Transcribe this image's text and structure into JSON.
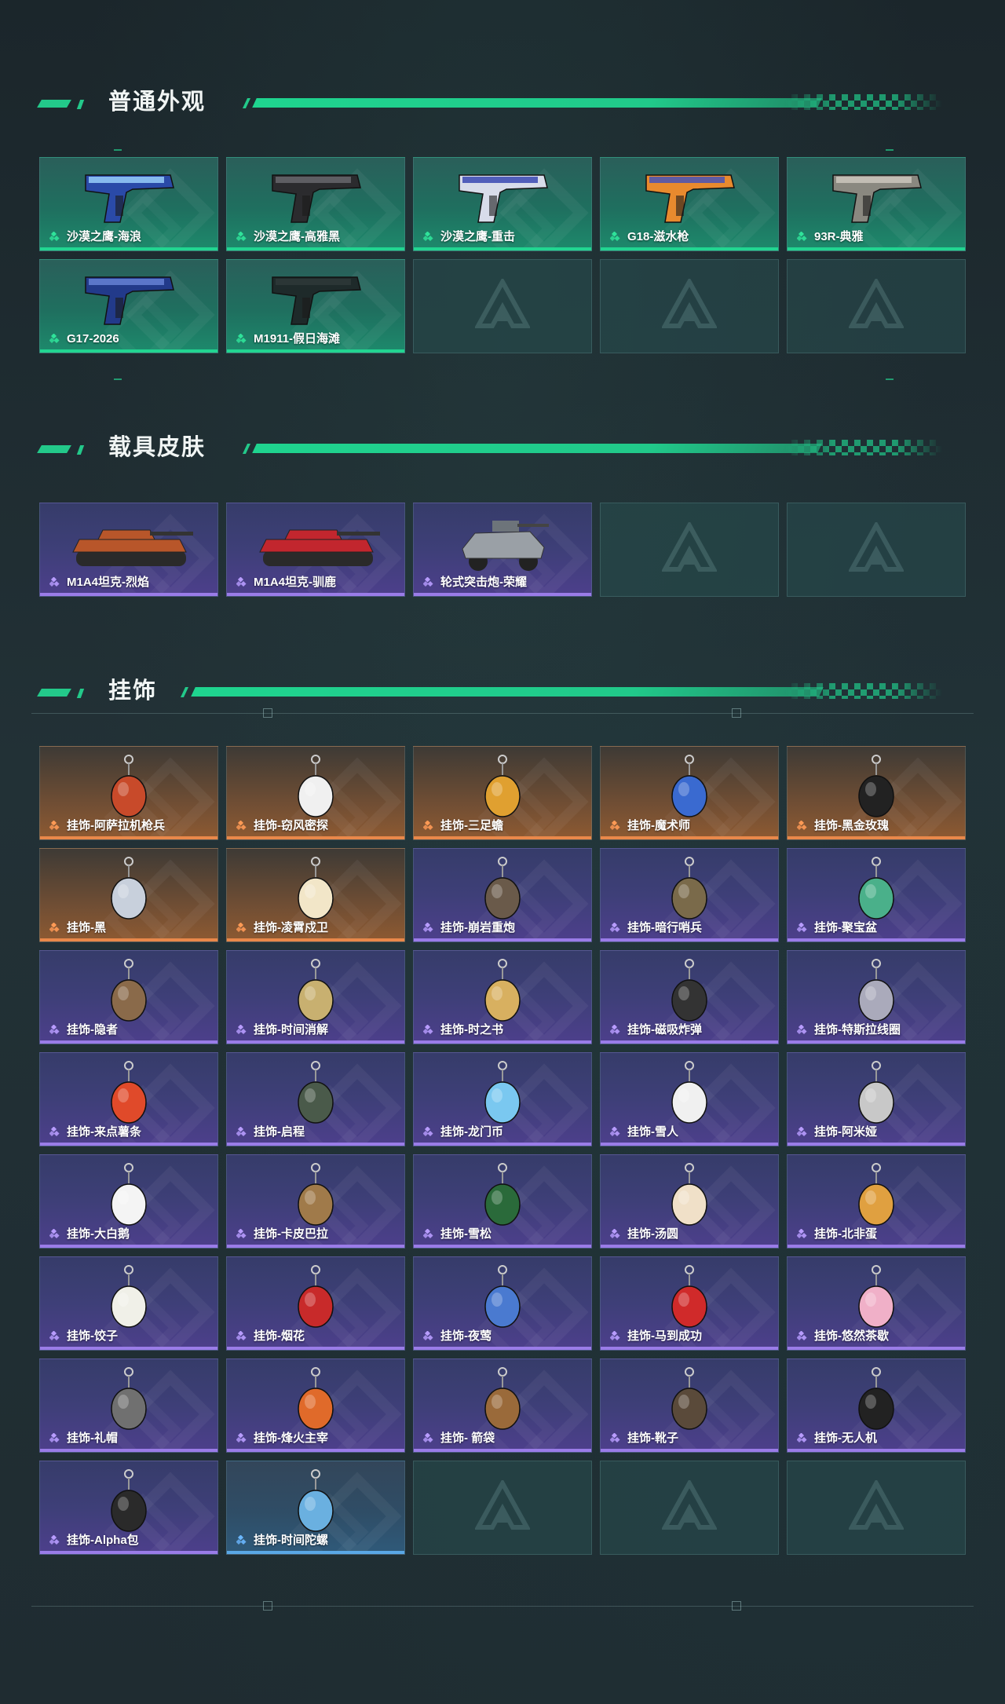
{
  "colors": {
    "accent_green": "#22d591",
    "purple_rarity": "#9a7ce8",
    "orange_rarity": "#e9884a",
    "blue_rarity": "#5aa8e6"
  },
  "sections": [
    {
      "title": "普通外观",
      "items": [
        {
          "label": "沙漠之鹰-海浪",
          "rarity": "green",
          "icon": "pistol-icon"
        },
        {
          "label": "沙漠之鹰-高雅黑",
          "rarity": "green",
          "icon": "pistol-icon"
        },
        {
          "label": "沙漠之鹰-重击",
          "rarity": "green",
          "icon": "pistol-icon"
        },
        {
          "label": "G18-滋水枪",
          "rarity": "green",
          "icon": "pistol-icon"
        },
        {
          "label": "93R-典雅",
          "rarity": "green",
          "icon": "pistol-icon"
        },
        {
          "label": "G17-2026",
          "rarity": "green",
          "icon": "pistol-icon"
        },
        {
          "label": "M1911-假日海滩",
          "rarity": "green",
          "icon": "pistol-icon"
        },
        {
          "label": "",
          "rarity": "empty"
        },
        {
          "label": "",
          "rarity": "empty"
        },
        {
          "label": "",
          "rarity": "empty"
        }
      ]
    },
    {
      "title": "载具皮肤",
      "items": [
        {
          "label": "M1A4坦克-烈焰",
          "rarity": "purple",
          "icon": "tank-icon"
        },
        {
          "label": "M1A4坦克-驯鹿",
          "rarity": "purple",
          "icon": "tank-icon"
        },
        {
          "label": "轮式突击炮-荣耀",
          "rarity": "purple",
          "icon": "armored-car-icon"
        },
        {
          "label": "",
          "rarity": "empty"
        },
        {
          "label": "",
          "rarity": "empty"
        }
      ]
    },
    {
      "title": "挂饰",
      "items": [
        {
          "label": "挂饰-阿萨拉机枪兵",
          "rarity": "orange",
          "icon": "charm-icon"
        },
        {
          "label": "挂饰-窃风密探",
          "rarity": "orange",
          "icon": "charm-icon"
        },
        {
          "label": "挂饰-三足蟾",
          "rarity": "orange",
          "icon": "charm-icon"
        },
        {
          "label": "挂饰-魔术师",
          "rarity": "orange",
          "icon": "charm-icon"
        },
        {
          "label": "挂饰-黑金玫瑰",
          "rarity": "orange",
          "icon": "charm-icon"
        },
        {
          "label": "挂饰-黑",
          "rarity": "orange",
          "icon": "charm-icon"
        },
        {
          "label": "挂饰-凌霄戍卫",
          "rarity": "orange",
          "icon": "charm-icon"
        },
        {
          "label": "挂饰-崩岩重炮",
          "rarity": "purple",
          "icon": "charm-icon"
        },
        {
          "label": "挂饰-暗行哨兵",
          "rarity": "purple",
          "icon": "charm-icon"
        },
        {
          "label": "挂饰-聚宝盆",
          "rarity": "purple",
          "icon": "charm-icon"
        },
        {
          "label": "挂饰-隐者",
          "rarity": "purple",
          "icon": "charm-icon"
        },
        {
          "label": "挂饰-时间消解",
          "rarity": "purple",
          "icon": "charm-icon"
        },
        {
          "label": "挂饰-时之书",
          "rarity": "purple",
          "icon": "charm-icon"
        },
        {
          "label": "挂饰-磁吸炸弹",
          "rarity": "purple",
          "icon": "charm-icon"
        },
        {
          "label": "挂饰-特斯拉线圈",
          "rarity": "purple",
          "icon": "charm-icon"
        },
        {
          "label": "挂饰-来点薯条",
          "rarity": "purple",
          "icon": "charm-icon"
        },
        {
          "label": "挂饰-启程",
          "rarity": "purple",
          "icon": "charm-icon"
        },
        {
          "label": "挂饰-龙门币",
          "rarity": "purple",
          "icon": "charm-icon"
        },
        {
          "label": "挂饰-雪人",
          "rarity": "purple",
          "icon": "charm-icon"
        },
        {
          "label": "挂饰-阿米娅",
          "rarity": "purple",
          "icon": "charm-icon"
        },
        {
          "label": "挂饰-大白鹅",
          "rarity": "purple",
          "icon": "charm-icon"
        },
        {
          "label": "挂饰-卡皮巴拉",
          "rarity": "purple",
          "icon": "charm-icon"
        },
        {
          "label": "挂饰-雪松",
          "rarity": "purple",
          "icon": "charm-icon"
        },
        {
          "label": "挂饰-汤圆",
          "rarity": "purple",
          "icon": "charm-icon"
        },
        {
          "label": "挂饰-北非蛋",
          "rarity": "purple",
          "icon": "charm-icon"
        },
        {
          "label": "挂饰-饺子",
          "rarity": "purple",
          "icon": "charm-icon"
        },
        {
          "label": "挂饰-烟花",
          "rarity": "purple",
          "icon": "charm-icon"
        },
        {
          "label": "挂饰-夜莺",
          "rarity": "purple",
          "icon": "charm-icon"
        },
        {
          "label": "挂饰-马到成功",
          "rarity": "purple",
          "icon": "charm-icon"
        },
        {
          "label": "挂饰-悠然茶歇",
          "rarity": "purple",
          "icon": "charm-icon"
        },
        {
          "label": "挂饰-礼帽",
          "rarity": "purple",
          "icon": "charm-icon"
        },
        {
          "label": "挂饰-烽火主宰",
          "rarity": "purple",
          "icon": "charm-icon"
        },
        {
          "label": "挂饰- 箭袋",
          "rarity": "purple",
          "icon": "charm-icon"
        },
        {
          "label": "挂饰-靴子",
          "rarity": "purple",
          "icon": "charm-icon"
        },
        {
          "label": "挂饰-无人机",
          "rarity": "purple",
          "icon": "charm-icon"
        },
        {
          "label": "挂饰-Alpha包",
          "rarity": "purple",
          "icon": "charm-icon"
        },
        {
          "label": "挂饰-时间陀螺",
          "rarity": "blue",
          "icon": "charm-icon"
        },
        {
          "label": "",
          "rarity": "empty"
        },
        {
          "label": "",
          "rarity": "empty"
        },
        {
          "label": "",
          "rarity": "empty"
        }
      ]
    }
  ]
}
